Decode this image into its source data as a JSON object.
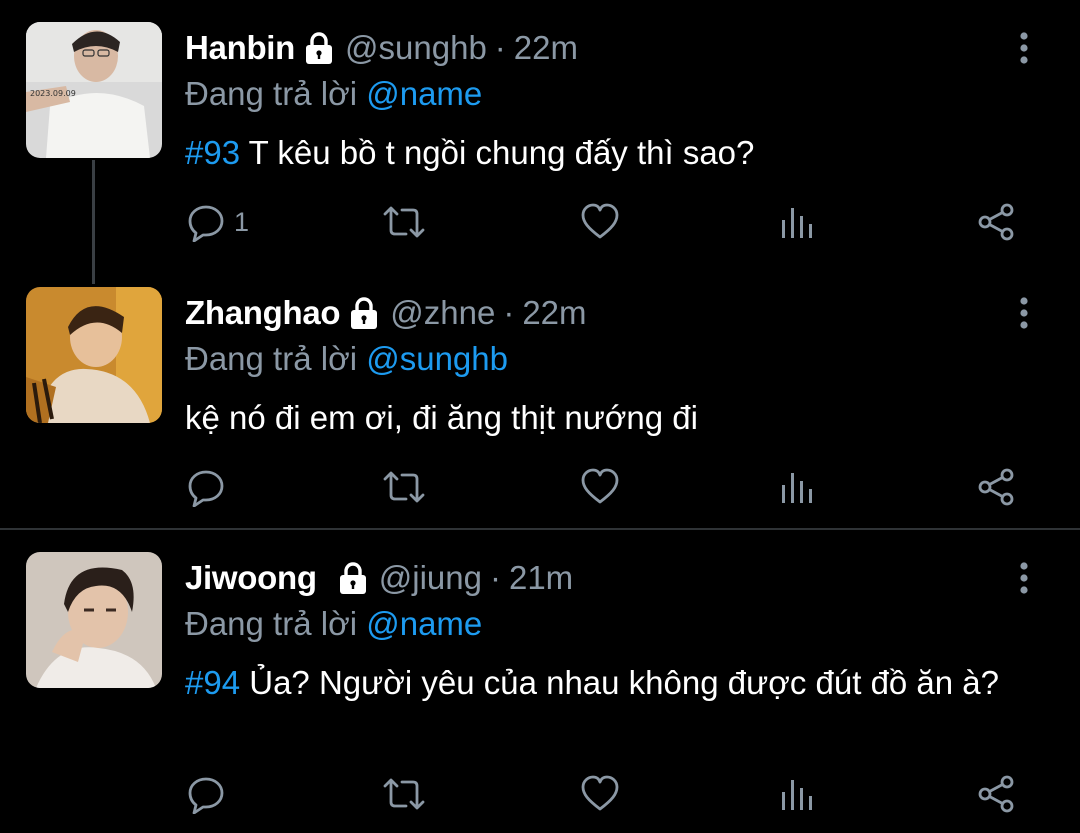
{
  "colors": {
    "background": "#000000",
    "text": "#ffffff",
    "muted": "#8b98a5",
    "accent": "#1d9bf0"
  },
  "tweets": [
    {
      "display_name": "Hanbin",
      "handle": "@sunghb",
      "separator": "·",
      "time": "22m",
      "locked": true,
      "reply_prefix": "Đang trả lời",
      "reply_to": "@name",
      "hashtag": "#93",
      "text": "T kêu bồ t ngồi chung đấy thì sao?",
      "reply_count": "1",
      "icons": [
        "reply-icon",
        "retweet-icon",
        "like-icon",
        "views-icon",
        "share-icon",
        "more-icon",
        "lock-icon"
      ]
    },
    {
      "display_name": "Zhanghao",
      "handle": "@zhne",
      "separator": "·",
      "time": "22m",
      "locked": true,
      "reply_prefix": "Đang trả lời",
      "reply_to": "@sunghb",
      "hashtag": "",
      "text": "kệ nó đi em ơi, đi ăng thịt nướng đi",
      "reply_count": "",
      "icons": [
        "reply-icon",
        "retweet-icon",
        "like-icon",
        "views-icon",
        "share-icon",
        "more-icon",
        "lock-icon"
      ]
    },
    {
      "display_name": "Jiwoong",
      "handle": "@jiung",
      "separator": "·",
      "time": "21m",
      "locked": true,
      "reply_prefix": "Đang trả lời",
      "reply_to": "@name",
      "hashtag": "#94",
      "text": "Ủa? Người yêu của nhau không được đút đồ ăn à?",
      "reply_count": "",
      "icons": [
        "reply-icon",
        "retweet-icon",
        "like-icon",
        "views-icon",
        "share-icon",
        "more-icon",
        "lock-icon"
      ]
    }
  ]
}
